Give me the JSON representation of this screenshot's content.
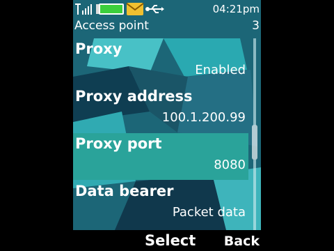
{
  "status": {
    "time": "04:21pm",
    "icons": [
      "signal-icon",
      "battery-icon",
      "message-icon",
      "usb-icon"
    ]
  },
  "title": {
    "text": "Access point",
    "index": "3"
  },
  "items": [
    {
      "label": "Proxy",
      "value": "Enabled"
    },
    {
      "label": "Proxy address",
      "value": "100.1.200.99"
    },
    {
      "label": "Proxy port",
      "value": "8080"
    },
    {
      "label": "Data bearer",
      "value": "Packet data"
    }
  ],
  "selected_index": 2,
  "scroll_position": 0.55,
  "softkeys": {
    "left": "Select",
    "right": "Back"
  },
  "colors": {
    "background": "#1f6f80",
    "highlight": "#2aa39a",
    "battery": "#3ccf3c",
    "message": "#f0c030"
  }
}
